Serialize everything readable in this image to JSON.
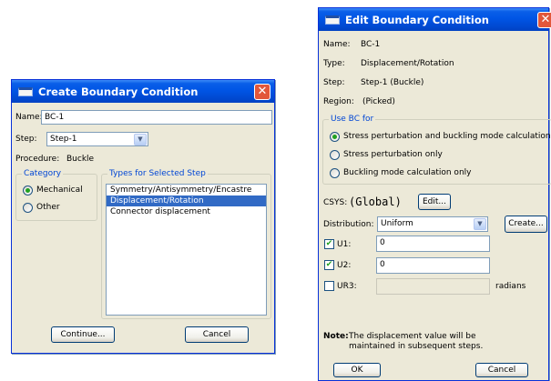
{
  "create_dialog": {
    "title": "Create Boundary Condition",
    "name_label": "Name:",
    "name_value": "BC-1",
    "step_label": "Step:",
    "step_value": "Step-1",
    "procedure_label": "Procedure:",
    "procedure_value": "Buckle",
    "category_title": "Category",
    "category_options": [
      "Mechanical",
      "Other"
    ],
    "category_selected": "Mechanical",
    "types_title": "Types for Selected Step",
    "types": [
      "Symmetry/Antisymmetry/Encastre",
      "Displacement/Rotation",
      "Connector displacement"
    ],
    "types_selected": "Displacement/Rotation",
    "continue_label": "Continue...",
    "cancel_label": "Cancel"
  },
  "edit_dialog": {
    "title": "Edit Boundary Condition",
    "info": [
      {
        "label": "Name:",
        "value": "BC-1"
      },
      {
        "label": "Type:",
        "value": "Displacement/Rotation"
      },
      {
        "label": "Step:",
        "value": "Step-1 (Buckle)"
      },
      {
        "label": "Region:",
        "value": "(Picked)"
      }
    ],
    "use_bc_title": "Use BC for",
    "use_bc_options": [
      "Stress perturbation and buckling mode calculation",
      "Stress perturbation only",
      "Buckling mode calculation only"
    ],
    "use_bc_selected": "Stress perturbation and buckling mode calculation",
    "csys_label": "CSYS:",
    "csys_value": "(Global)",
    "csys_edit_label": "Edit...",
    "distribution_label": "Distribution:",
    "distribution_value": "Uniform",
    "create_label": "Create...",
    "dofs": [
      {
        "label": "U1:",
        "checked": true,
        "value": "0"
      },
      {
        "label": "U2:",
        "checked": true,
        "value": "0"
      },
      {
        "label": "UR3:",
        "checked": false,
        "value": ""
      }
    ],
    "ur3_unit": "radians",
    "note_label": "Note:",
    "note_line1": "The displacement value will be",
    "note_line2": "maintained in subsequent steps.",
    "ok_label": "OK",
    "cancel_label": "Cancel"
  }
}
